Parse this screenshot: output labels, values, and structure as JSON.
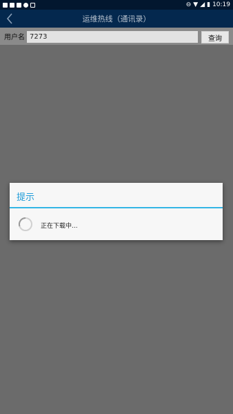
{
  "statusbar": {
    "left_icons": [
      "app-icon",
      "app-icon",
      "image-icon",
      "shield-icon",
      "x-icon"
    ],
    "right_icons": [
      "dnd-icon",
      "wifi-icon",
      "signal-icon",
      "battery-icon"
    ],
    "time": "10:19"
  },
  "appbar": {
    "title": "运维热线（通讯录）"
  },
  "search": {
    "label": "用户名",
    "value": "7273",
    "button_label": "查询"
  },
  "dialog": {
    "title": "提示",
    "message": "正在下载中..."
  },
  "colors": {
    "accent": "#33b5e5",
    "appbar": "#04284e",
    "statusbar": "#02172f",
    "overlay": "#6b6b6b"
  }
}
